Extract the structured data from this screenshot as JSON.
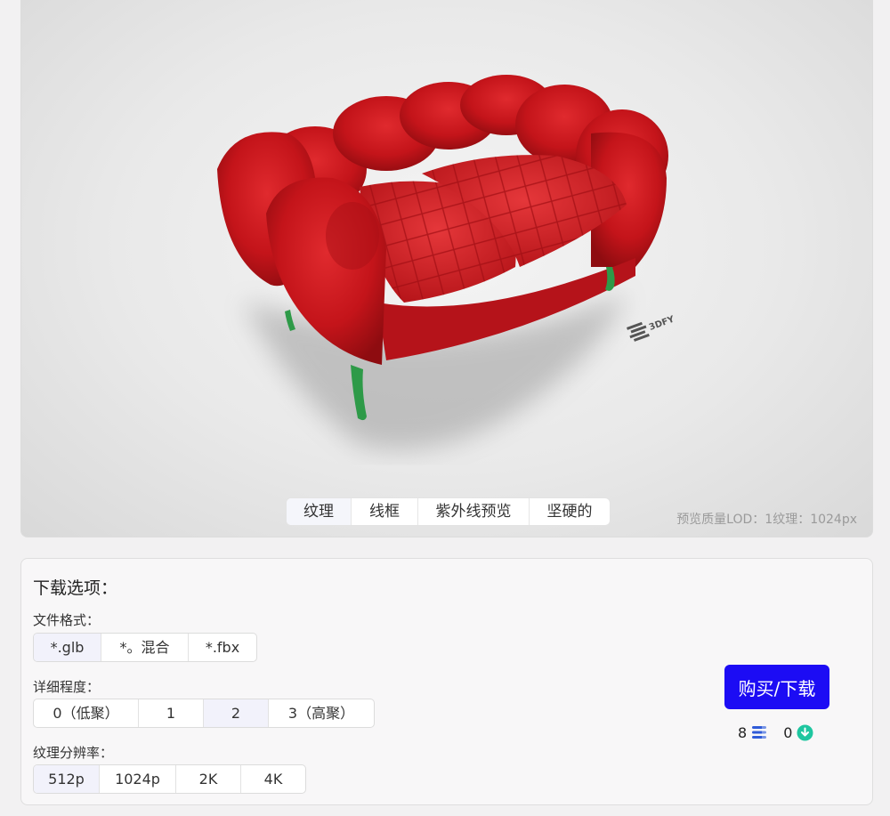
{
  "viewer": {
    "watermark_logo": "3DFY.ai",
    "tabs": [
      {
        "label": "纹理",
        "active": true
      },
      {
        "label": "线框",
        "active": false
      },
      {
        "label": "紫外线预览",
        "active": false
      },
      {
        "label": "坚硬的",
        "active": false
      }
    ],
    "lod_text": "预览质量LOD：1纹理：1024px"
  },
  "download": {
    "title": "下载选项：",
    "format_label": "文件格式：",
    "formats": [
      {
        "label": "*.glb",
        "active": true
      },
      {
        "label": "*。混合",
        "active": false
      },
      {
        "label": "*.fbx",
        "active": false
      }
    ],
    "detail_label": "详细程度：",
    "details": [
      {
        "label": "0（低聚）",
        "active": false
      },
      {
        "label": "1",
        "active": false
      },
      {
        "label": "2",
        "active": true
      },
      {
        "label": "3（高聚）",
        "active": false
      }
    ],
    "texture_label": "纹理分辨率：",
    "textures": [
      {
        "label": "512p",
        "active": true
      },
      {
        "label": "1024p",
        "active": false
      },
      {
        "label": "2K",
        "active": false
      },
      {
        "label": "4K",
        "active": false
      }
    ],
    "buy_label": "购买/下载",
    "credits_count": "8",
    "credits_icon": "stack-icon",
    "downloads_count": "0",
    "downloads_icon": "download-circle-icon"
  },
  "colors": {
    "accent": "#1c0cf4",
    "sofa_red": "#c8151b",
    "leg_green": "#2e9a48",
    "download_icon": "#1fc6a0",
    "stack_icon": "#2f5bd8"
  }
}
